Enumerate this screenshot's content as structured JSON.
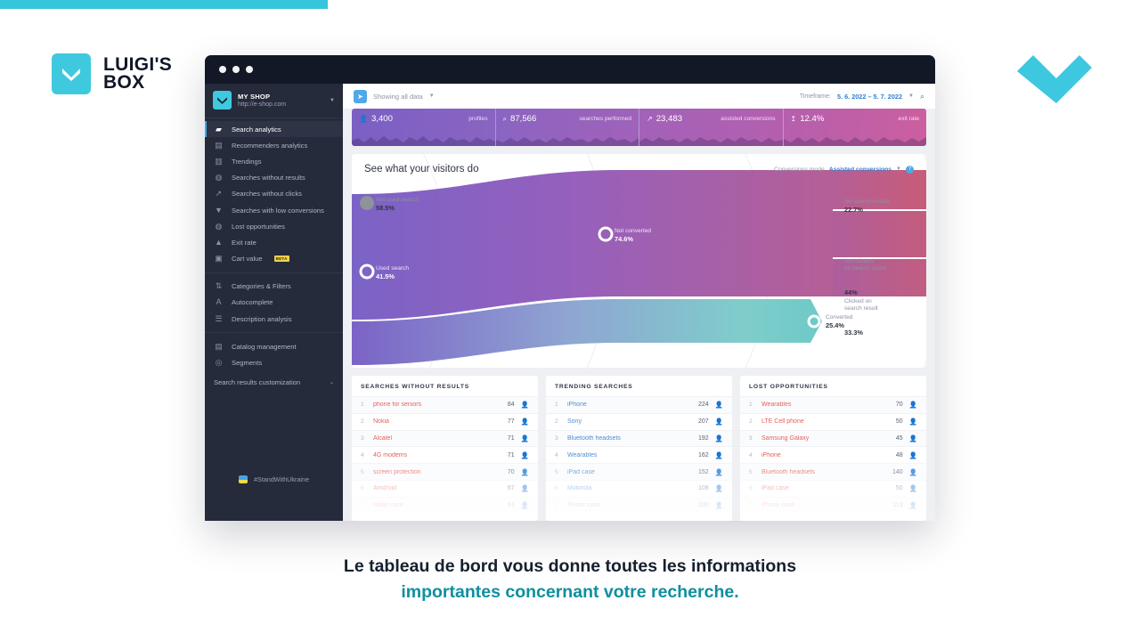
{
  "brand": {
    "logo_line1": "LUIGI'S",
    "logo_line2": "BOX",
    "accent_color": "#3fc9de",
    "strip_color": "#35c6dc"
  },
  "window": {
    "dots": 3
  },
  "sidebar": {
    "shop_name": "MY SHOP",
    "shop_url": "http://e-shop.com",
    "groups": [
      {
        "items": [
          {
            "label": "Search analytics",
            "icon": "chat-bubble-icon",
            "active": true
          },
          {
            "label": "Recommenders analytics",
            "icon": "report-icon",
            "active": false
          },
          {
            "label": "Trendings",
            "icon": "bar-chart-icon",
            "active": false
          },
          {
            "label": "Searches without results",
            "icon": "search-broken-icon",
            "active": false
          },
          {
            "label": "Searches without clicks",
            "icon": "cursor-icon",
            "active": false
          },
          {
            "label": "Searches with low conversions",
            "icon": "thumbs-down-icon",
            "active": false
          },
          {
            "label": "Lost opportunities",
            "icon": "coin-icon",
            "active": false
          },
          {
            "label": "Exit rate",
            "icon": "exit-chart-icon",
            "active": false
          },
          {
            "label": "Cart value",
            "icon": "basket-icon",
            "active": false,
            "badge": "BETA"
          }
        ]
      },
      {
        "items": [
          {
            "label": "Categories & Filters",
            "icon": "sliders-icon",
            "active": false
          },
          {
            "label": "Autocomplete",
            "icon": "text-cursor-icon",
            "active": false
          },
          {
            "label": "Description analysis",
            "icon": "lines-icon",
            "active": false
          }
        ]
      },
      {
        "items": [
          {
            "label": "Catalog management",
            "icon": "book-icon",
            "active": false
          },
          {
            "label": "Segments",
            "icon": "target-icon",
            "active": false
          }
        ]
      }
    ],
    "customization_label": "Search results customization",
    "ukraine_tag": "#StandWithUkraine"
  },
  "toolbar": {
    "data_scope": "Showing all data",
    "timeframe_label": "Timeframe:",
    "timeframe_value": "5. 6. 2022 – 5. 7. 2022",
    "search_icon": "search-icon"
  },
  "metrics": [
    {
      "icon": "profile-icon",
      "value": "3,400",
      "label": "profiles"
    },
    {
      "icon": "magnifier-icon",
      "value": "87,566",
      "label": "searches performed"
    },
    {
      "icon": "trend-icon",
      "value": "23,483",
      "label": "assisted conversions"
    },
    {
      "icon": "exit-icon",
      "value": "12.4%",
      "label": "exit rate"
    }
  ],
  "sankey": {
    "title": "See what your visitors do",
    "conversions_mode_label": "Conversions mode",
    "conversions_mode_value": "Assisted conversions",
    "help_icon": "question-mark-icon",
    "nodes": [
      {
        "name": "Not used search",
        "pct": "58.5%"
      },
      {
        "name": "Used search",
        "pct": "41.5%"
      },
      {
        "name": "Not converted",
        "pct": "74.6%"
      },
      {
        "name": "Converted",
        "pct": "25.4%"
      },
      {
        "name": "No search results",
        "pct": "22.7%"
      },
      {
        "name": "Not clicked\non search result",
        "pct": "44%"
      },
      {
        "name": "Clicked on\nsearch result",
        "pct": "33.3%"
      }
    ]
  },
  "tables": [
    {
      "title": "SEARCHES WITHOUT RESULTS",
      "tone": "red",
      "rows": [
        {
          "rank": "1",
          "term": "phone for seniors",
          "count": "84"
        },
        {
          "rank": "2",
          "term": "Nokia",
          "count": "77"
        },
        {
          "rank": "3",
          "term": "Alcatel",
          "count": "71"
        },
        {
          "rank": "4",
          "term": "4G modems",
          "count": "71"
        },
        {
          "rank": "5",
          "term": "screen protection",
          "count": "70"
        },
        {
          "rank": "6",
          "term": "Amdroid",
          "count": "67"
        },
        {
          "rank": "7",
          "term": "tablet case",
          "count": "61"
        }
      ]
    },
    {
      "title": "TRENDING SEARCHES",
      "tone": "blue",
      "rows": [
        {
          "rank": "1",
          "term": "iPhone",
          "count": "224"
        },
        {
          "rank": "2",
          "term": "Sony",
          "count": "207"
        },
        {
          "rank": "3",
          "term": "Bluetooth headsets",
          "count": "192"
        },
        {
          "rank": "4",
          "term": "Wearables",
          "count": "162"
        },
        {
          "rank": "5",
          "term": "iPad case",
          "count": "152"
        },
        {
          "rank": "6",
          "term": "Motorola",
          "count": "108"
        },
        {
          "rank": "7",
          "term": "Phone case",
          "count": "100"
        }
      ]
    },
    {
      "title": "LOST OPPORTUNITIES",
      "tone": "red",
      "rows": [
        {
          "rank": "1",
          "term": "Wearables",
          "count": "70"
        },
        {
          "rank": "2",
          "term": "LTE Cell phone",
          "count": "50"
        },
        {
          "rank": "3",
          "term": "Samsung Galaxy",
          "count": "45"
        },
        {
          "rank": "4",
          "term": "iPhone",
          "count": "48"
        },
        {
          "rank": "5",
          "term": "Bluetooth headsets",
          "count": "140"
        },
        {
          "rank": "6",
          "term": "iPad case",
          "count": "50"
        },
        {
          "rank": "7",
          "term": "Phone case",
          "count": "113"
        }
      ]
    }
  ],
  "caption": {
    "line1": "Le tableau de bord vous donne toutes les informations",
    "line2": "importantes concernant votre recherche.",
    "highlight_color": "#0e8fa0"
  }
}
